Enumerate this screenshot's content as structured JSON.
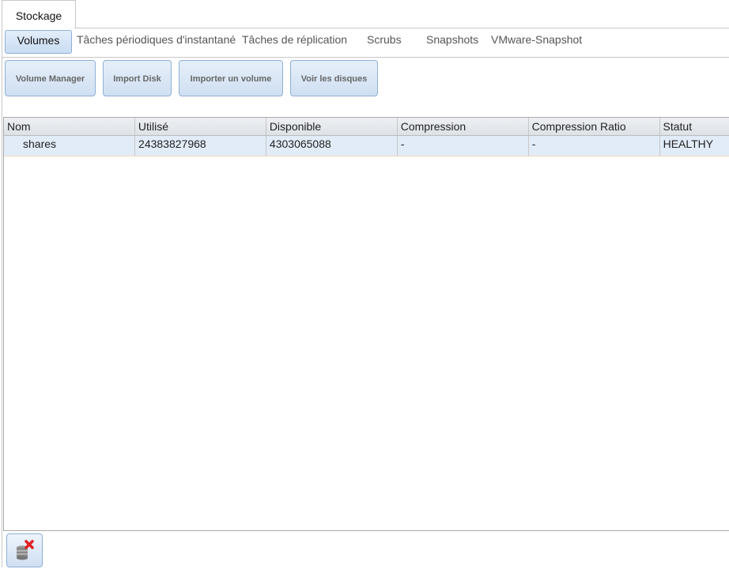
{
  "main_tab": "Stockage",
  "subtabs": [
    "Volumes",
    "Tâches périodiques d'instantané",
    "Tâches de réplication",
    "Scrubs",
    "Snapshots",
    "VMware-Snapshot"
  ],
  "buttons": [
    "Volume Manager",
    "Import Disk",
    "Importer un volume",
    "Voir les disques"
  ],
  "table": {
    "columns": [
      "Nom",
      "Utilisé",
      "Disponible",
      "Compression",
      "Compression Ratio",
      "Statut"
    ],
    "rows": [
      [
        "shares",
        "24383827968",
        "4303065088",
        "-",
        "-",
        "HEALTHY"
      ]
    ]
  },
  "bottom_button_icon": "delete-volume-icon"
}
